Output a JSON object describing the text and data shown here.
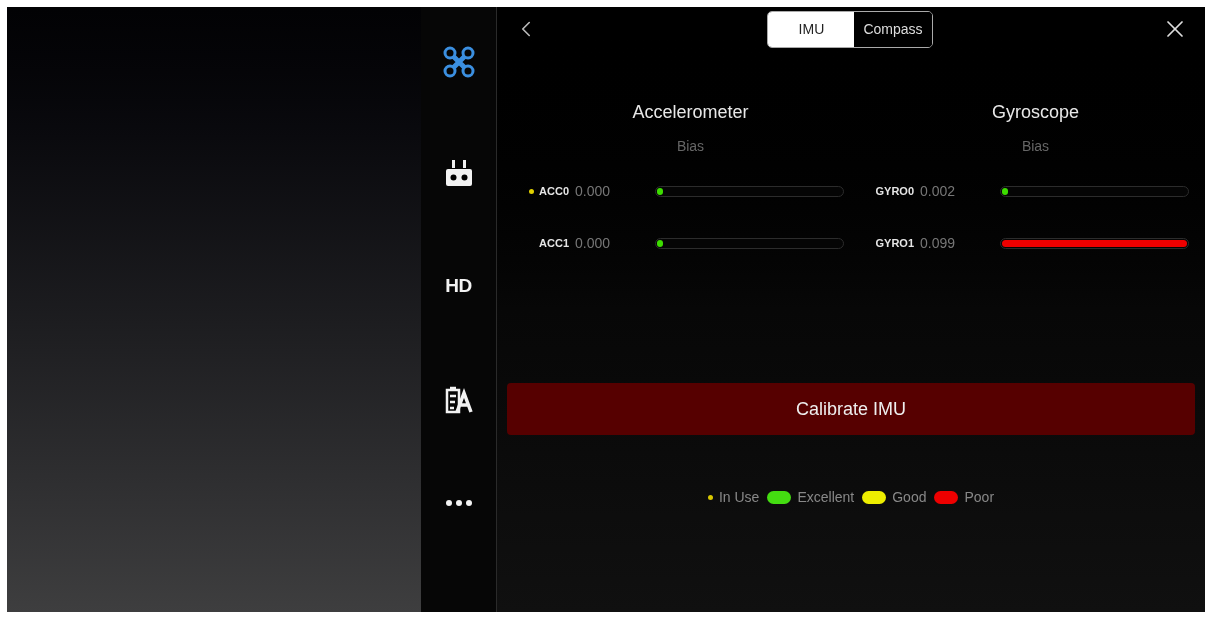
{
  "sidebar": {
    "items": [
      {
        "kind": "drone",
        "selected": true
      },
      {
        "kind": "remote",
        "selected": false
      },
      {
        "kind": "text",
        "label": "HD",
        "selected": false
      },
      {
        "kind": "checklist",
        "selected": false
      },
      {
        "kind": "more",
        "selected": false
      }
    ]
  },
  "tabs": [
    {
      "label": "IMU",
      "selected": true
    },
    {
      "label": "Compass",
      "selected": false
    }
  ],
  "sections": [
    {
      "title": "Accelerometer",
      "subtitle": "Bias",
      "sensors": [
        {
          "name": "ACC0",
          "value": "0.000",
          "in_use": true,
          "level": 0.03,
          "color": "#3ddc00"
        },
        {
          "name": "ACC1",
          "value": "0.000",
          "in_use": false,
          "level": 0.03,
          "color": "#3ddc00"
        }
      ]
    },
    {
      "title": "Gyroscope",
      "subtitle": "Bias",
      "sensors": [
        {
          "name": "GYRO0",
          "value": "0.002",
          "in_use": false,
          "level": 0.03,
          "color": "#3ddc00"
        },
        {
          "name": "GYRO1",
          "value": "0.099",
          "in_use": false,
          "level": 1,
          "color": "#ee0000"
        }
      ]
    }
  ],
  "calibrate_button": "Calibrate IMU",
  "legend": [
    {
      "kind": "dot",
      "label": "In Use",
      "color": "#d8c800"
    },
    {
      "kind": "pill",
      "label": "Excellent",
      "color": "#44dd11"
    },
    {
      "kind": "pill",
      "label": "Good",
      "color": "#eeee00"
    },
    {
      "kind": "pill",
      "label": "Poor",
      "color": "#ee0000"
    }
  ]
}
